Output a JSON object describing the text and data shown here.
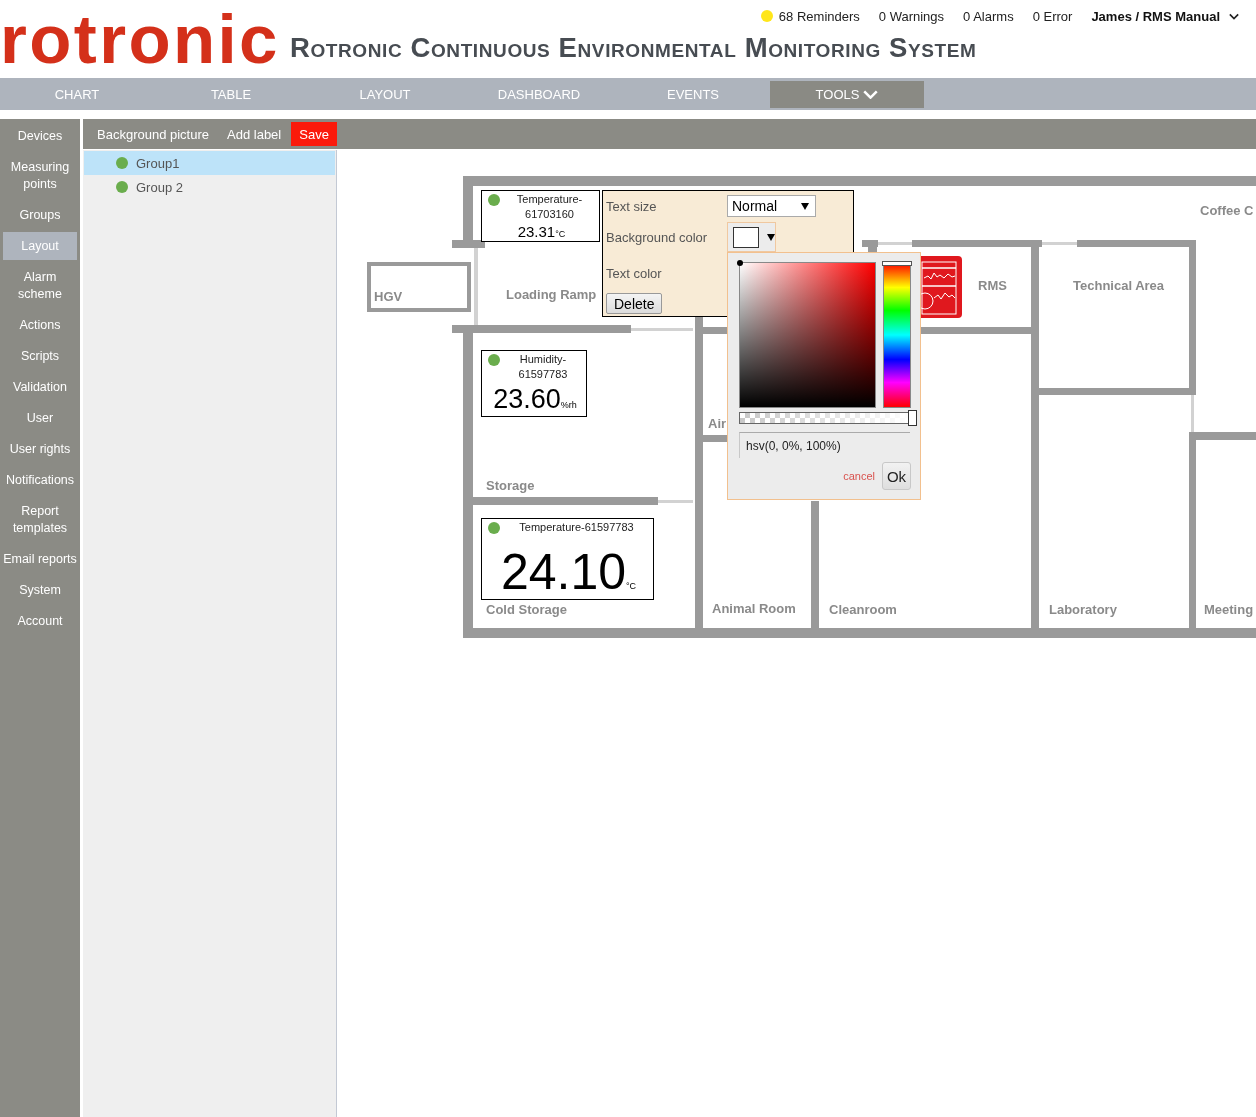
{
  "header": {
    "logo": "rotronic",
    "title": "Rotronic Continuous Environmental Monitoring System",
    "status": [
      {
        "label": "68 Reminders",
        "color": "#ffe61a"
      },
      {
        "label": "0 Warnings"
      },
      {
        "label": "0 Alarms"
      },
      {
        "label": "0 Error"
      }
    ],
    "user": "James / RMS Manual"
  },
  "nav": [
    {
      "label": "CHART",
      "selected": false,
      "dropdown": false
    },
    {
      "label": "TABLE",
      "selected": false,
      "dropdown": false
    },
    {
      "label": "LAYOUT",
      "selected": false,
      "dropdown": false
    },
    {
      "label": "DASHBOARD",
      "selected": false,
      "dropdown": false
    },
    {
      "label": "EVENTS",
      "selected": false,
      "dropdown": false
    },
    {
      "label": "TOOLS",
      "selected": true,
      "dropdown": true
    }
  ],
  "sidebar": {
    "items": [
      {
        "label": "Devices",
        "selected": false
      },
      {
        "label": "Measuring points",
        "selected": false
      },
      {
        "label": "Groups",
        "selected": false
      },
      {
        "label": "Layout",
        "selected": true
      },
      {
        "label": "Alarm scheme",
        "selected": false
      },
      {
        "label": "Actions",
        "selected": false
      },
      {
        "label": "Scripts",
        "selected": false
      },
      {
        "label": "Validation",
        "selected": false
      },
      {
        "label": "User",
        "selected": false
      },
      {
        "label": "User rights",
        "selected": false
      },
      {
        "label": "Notifications",
        "selected": false
      },
      {
        "label": "Report templates",
        "selected": false
      },
      {
        "label": "Email reports",
        "selected": false
      },
      {
        "label": "System",
        "selected": false
      },
      {
        "label": "Account",
        "selected": false
      }
    ]
  },
  "toolbar": {
    "items": [
      {
        "label": "Background picture",
        "kind": "link"
      },
      {
        "label": "Add label",
        "kind": "link"
      },
      {
        "label": "Save",
        "kind": "primary"
      }
    ]
  },
  "groups": [
    {
      "label": "Group1",
      "selected": true,
      "color": "#6aad4d"
    },
    {
      "label": "Group 2",
      "selected": false,
      "color": "#6aad4d"
    }
  ],
  "canvas": {
    "rooms": [
      "Coffee C",
      "HGV",
      "Loading Ramp",
      "RMS",
      "Technical Area",
      "Air",
      "Storage",
      "Cold Storage",
      "Animal Room",
      "Cleanroom",
      "Laboratory",
      "Meeting"
    ],
    "sensors": [
      {
        "name": "Temperature-61703160",
        "value": "23.31",
        "unit": "°C",
        "color": "#6aad4d"
      },
      {
        "name": "Humidity-61597783",
        "value": "23.60",
        "unit": "%rh",
        "color": "#6aad4d"
      },
      {
        "name": "Temperature-61597783",
        "value": "24.10",
        "unit": "°C",
        "color": "#6aad4d"
      }
    ],
    "label_editor": {
      "rows": [
        {
          "label": "Text size",
          "kind": "select",
          "value": "Normal"
        },
        {
          "label": "Background color",
          "kind": "color",
          "color": "#ffffff"
        },
        {
          "label": "Text color",
          "kind": "hidden"
        }
      ],
      "delete_button": "Delete"
    },
    "color_picker": {
      "hue_slider": {
        "level": 0
      },
      "alpha_slider": {
        "level": 1
      },
      "value": "hsv(0, 0%, 100%)",
      "cancel": "cancel",
      "ok": "Ok"
    }
  }
}
